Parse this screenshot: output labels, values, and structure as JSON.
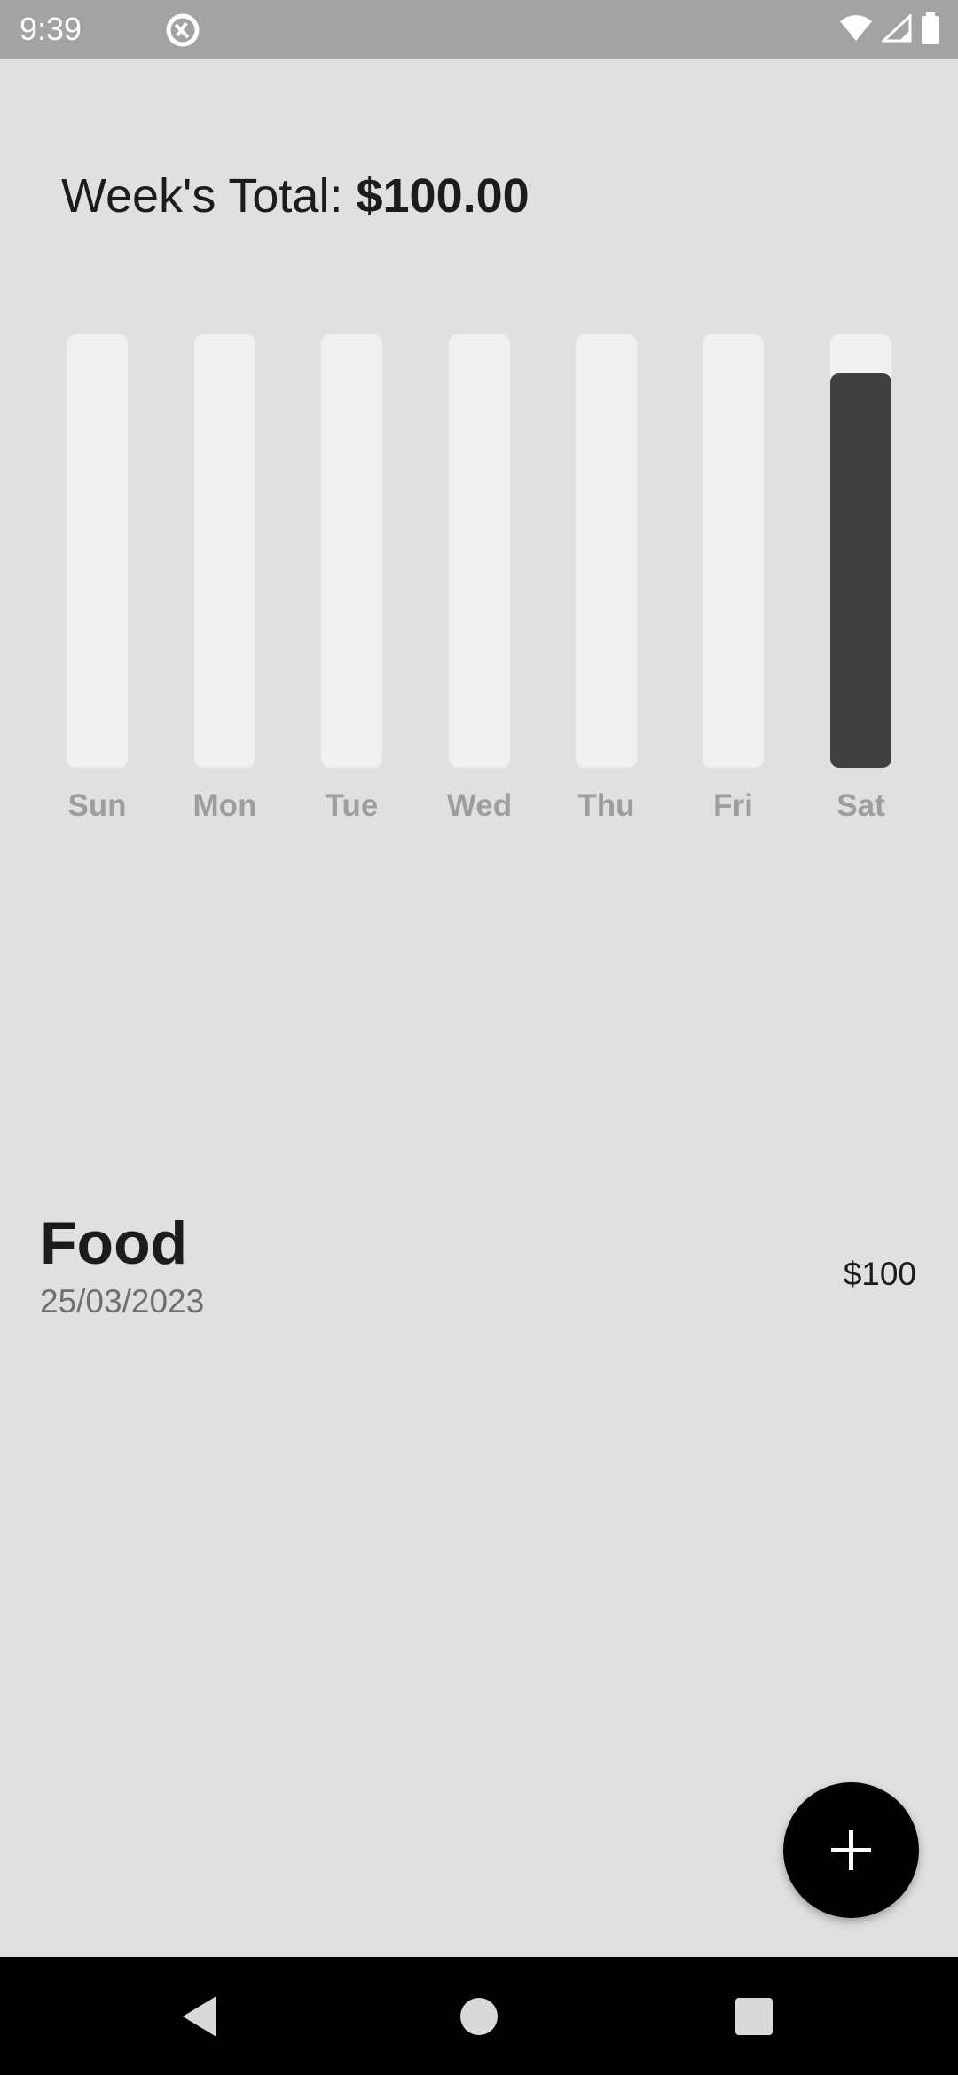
{
  "status_bar": {
    "time": "9:39",
    "icons": [
      "app-notification-icon",
      "wifi-icon",
      "signal-icon",
      "battery-icon"
    ]
  },
  "header": {
    "week_total_prefix": "Week's Total: ",
    "week_total_amount": "$100.00"
  },
  "chart_data": {
    "type": "bar",
    "categories": [
      "Sun",
      "Mon",
      "Tue",
      "Wed",
      "Thu",
      "Fri",
      "Sat"
    ],
    "values": [
      0,
      0,
      0,
      0,
      0,
      0,
      100
    ],
    "fraction_of_week": [
      0,
      0,
      0,
      0,
      0,
      0,
      0.91
    ],
    "title": "",
    "xlabel": "",
    "ylabel": "",
    "ylim": [
      0,
      100
    ],
    "grid": false,
    "colors": {
      "track": "#f0f0f0",
      "fill": "#404040",
      "label": "#9e9e9e"
    }
  },
  "transactions": [
    {
      "title": "Food",
      "date": "25/03/2023",
      "amount": "$100"
    }
  ],
  "fab": {
    "icon": "plus-icon"
  },
  "nav_bar": {
    "buttons": [
      "back-icon",
      "home-icon",
      "recents-icon"
    ]
  }
}
